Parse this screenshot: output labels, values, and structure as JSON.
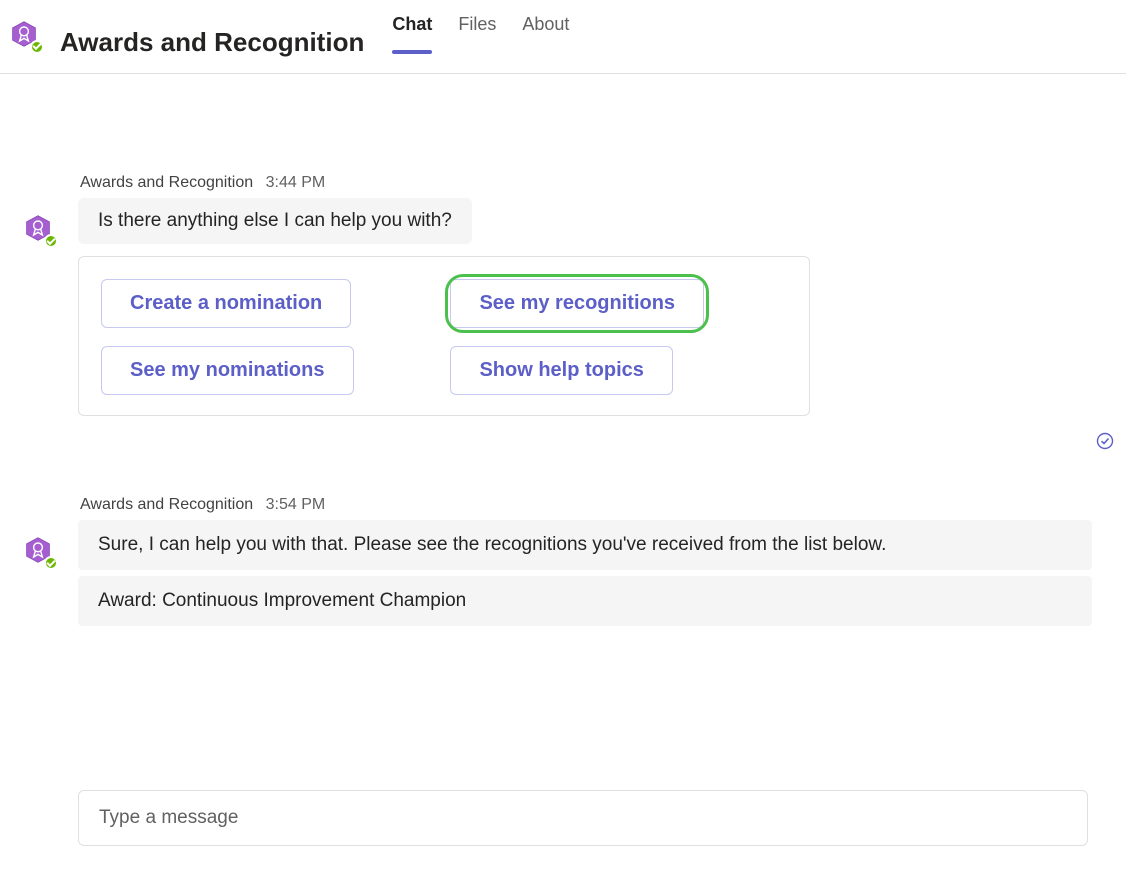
{
  "header": {
    "app_name": "Awards and Recognition",
    "tabs": [
      "Chat",
      "Files",
      "About"
    ],
    "active_tab": 0
  },
  "messages": [
    {
      "sender": "Awards and Recognition",
      "time": "3:44 PM",
      "text": "Is there anything else I can help you with?",
      "actions": [
        "Create a nomination",
        "See my recognitions",
        "See my nominations",
        "Show help topics"
      ],
      "highlighted_action": 1
    },
    {
      "sender": "Awards and Recognition",
      "time": "3:54 PM",
      "text": "Sure, I can help you with that. Please see the recognitions you've received from the list below.",
      "award_line": "Award: Continuous Improvement Champion"
    }
  ],
  "compose": {
    "placeholder": "Type a message"
  }
}
